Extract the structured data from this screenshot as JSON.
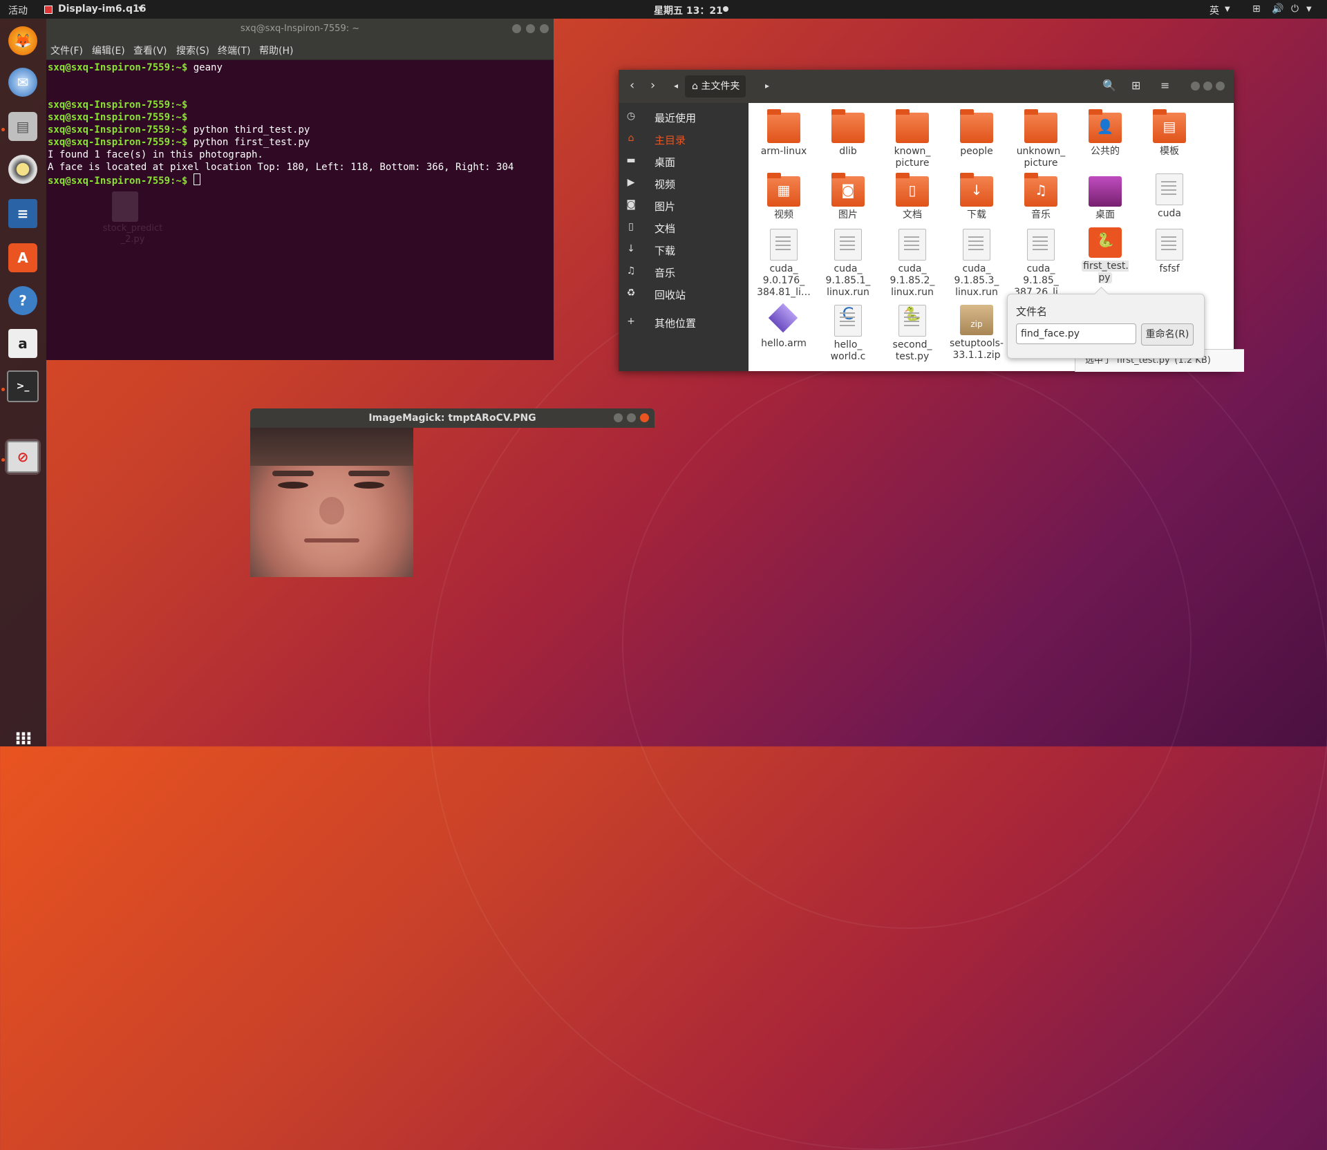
{
  "topbar": {
    "activities": "活动",
    "app_menu": "Display-im6.q16",
    "clock": "星期五 13：21",
    "input_method": "英"
  },
  "dock": {
    "items": [
      "firefox-icon",
      "thunderbird-icon",
      "files-icon",
      "rhythmbox-icon",
      "writer-icon",
      "software-icon",
      "help-icon",
      "amazon-icon",
      "terminal-icon",
      "imagemagick-icon"
    ],
    "show_apps": "show-applications-icon"
  },
  "desktop": {
    "file_label": "stock_predict_2.py"
  },
  "terminal": {
    "title": "sxq@sxq-Inspiron-7559: ~",
    "menu": [
      "文件(F)",
      "编辑(E)",
      "查看(V)",
      "搜索(S)",
      "终端(T)",
      "帮助(H)"
    ],
    "lines": [
      {
        "prompt": "sxq@sxq-Inspiron-7559:~$",
        "cmd": " geany"
      },
      {
        "prompt": "",
        "cmd": ""
      },
      {
        "prompt": "",
        "cmd": ""
      },
      {
        "prompt": "sxq@sxq-Inspiron-7559:~$",
        "cmd": ""
      },
      {
        "prompt": "sxq@sxq-Inspiron-7559:~$",
        "cmd": ""
      },
      {
        "prompt": "sxq@sxq-Inspiron-7559:~$",
        "cmd": " python third_test.py"
      },
      {
        "prompt": "sxq@sxq-Inspiron-7559:~$",
        "cmd": " python first_test.py"
      },
      {
        "prompt": "",
        "cmd": "I found 1 face(s) in this photograph."
      },
      {
        "prompt": "",
        "cmd": "A face is located at pixel location Top: 180, Left: 118, Bottom: 366, Right: 304"
      },
      {
        "prompt": "sxq@sxq-Inspiron-7559:~$",
        "cmd": " "
      }
    ]
  },
  "files": {
    "path": "主文件夹",
    "sidebar": [
      "最近使用",
      "主目录",
      "桌面",
      "视频",
      "图片",
      "文档",
      "下载",
      "音乐",
      "回收站",
      "其他位置"
    ],
    "sidebar_active": "主目录",
    "items": [
      {
        "name": "arm-linux",
        "kind": "folder"
      },
      {
        "name": "dlib",
        "kind": "folder"
      },
      {
        "name": "known_ picture",
        "kind": "folder"
      },
      {
        "name": "people",
        "kind": "folder"
      },
      {
        "name": "unknown_ picture",
        "kind": "folder"
      },
      {
        "name": "公共的",
        "kind": "folder"
      },
      {
        "name": "模板",
        "kind": "folder"
      },
      {
        "name": "视频",
        "kind": "folder"
      },
      {
        "name": "图片",
        "kind": "folder"
      },
      {
        "name": "文档",
        "kind": "folder"
      },
      {
        "name": "下载",
        "kind": "folder"
      },
      {
        "name": "音乐",
        "kind": "folder"
      },
      {
        "name": "桌面",
        "kind": "folder"
      },
      {
        "name": "cuda",
        "kind": "doc"
      },
      {
        "name": "cuda_ 9.0.176_ 384.81_li…",
        "kind": "doc"
      },
      {
        "name": "cuda_ 9.1.85.1_ linux.run",
        "kind": "doc"
      },
      {
        "name": "cuda_ 9.1.85.2_ linux.run",
        "kind": "doc"
      },
      {
        "name": "cuda_ 9.1.85.3_ linux.run",
        "kind": "doc"
      },
      {
        "name": "cuda_ 9.1.85_ 387.26_li…",
        "kind": "doc"
      },
      {
        "name": "first_test. py",
        "kind": "python-selected"
      },
      {
        "name": "fsfsf",
        "kind": "doc"
      },
      {
        "name": "hello.arm",
        "kind": "exec"
      },
      {
        "name": "hello_ world.c",
        "kind": "c"
      },
      {
        "name": "second_ test.py",
        "kind": "python"
      },
      {
        "name": "setuptools- 33.1.1.zip",
        "kind": "zip"
      }
    ],
    "rename": {
      "label": "文件名",
      "value": "find_face.py",
      "button": "重命名(R)"
    },
    "status": "选中了“first_test.py”(1.2 KB)"
  },
  "imagemagick": {
    "title": "ImageMagick: tmptARoCV.PNG"
  },
  "colors": {
    "accent": "#e95420",
    "terminal_bg": "#300a24",
    "prompt": "#8ae234"
  }
}
